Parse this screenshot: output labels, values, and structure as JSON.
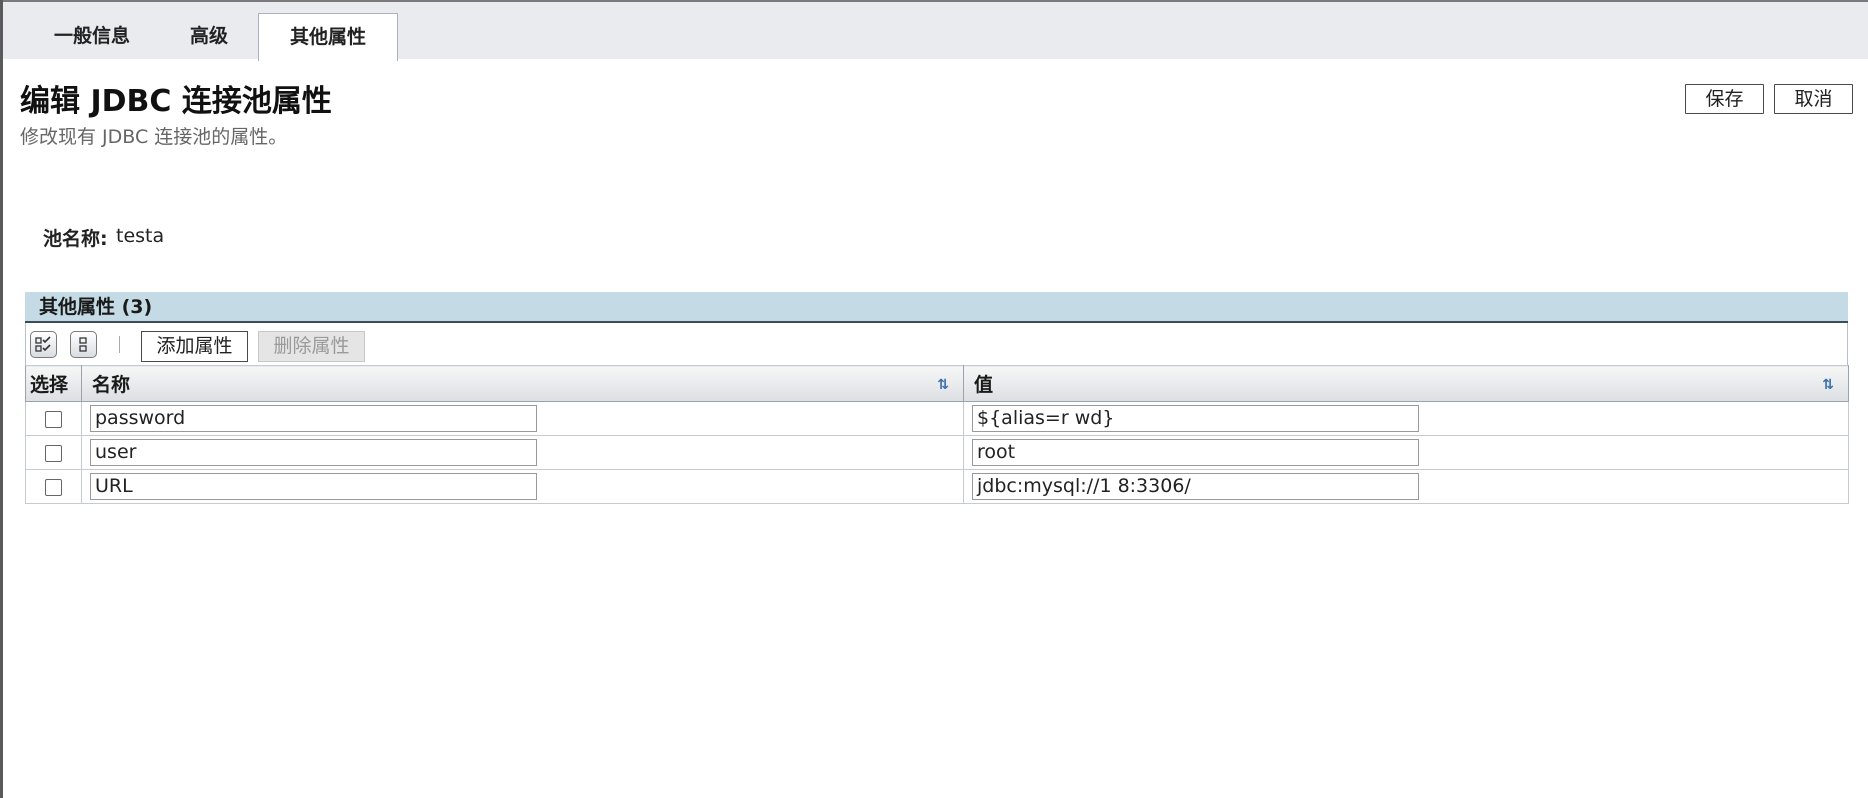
{
  "tabs": [
    {
      "label": "一般信息"
    },
    {
      "label": "高级"
    },
    {
      "label": "其他属性",
      "active": true
    }
  ],
  "header": {
    "title": "编辑 JDBC 连接池属性",
    "description": "修改现有 JDBC 连接池的属性。",
    "save_label": "保存",
    "cancel_label": "取消"
  },
  "pool": {
    "label": "池名称:",
    "value": "testa"
  },
  "table": {
    "title": "其他属性 (3)",
    "add_label": "添加属性",
    "delete_label": "删除属性",
    "columns": {
      "select": "选择",
      "name": "名称",
      "value": "值"
    },
    "rows": [
      {
        "name": "password",
        "value": "${alias=r       wd}"
      },
      {
        "name": "user",
        "value": "root"
      },
      {
        "name": "URL",
        "value": "jdbc:mysql://1          8:3306/"
      }
    ]
  },
  "icons": {
    "select_all": "select-all-icon",
    "deselect_all": "deselect-all-icon",
    "sort": "sort-icon"
  },
  "colors": {
    "panel_header_bg": "#c4dbe6",
    "tab_bar_bg": "#e9ebef"
  }
}
